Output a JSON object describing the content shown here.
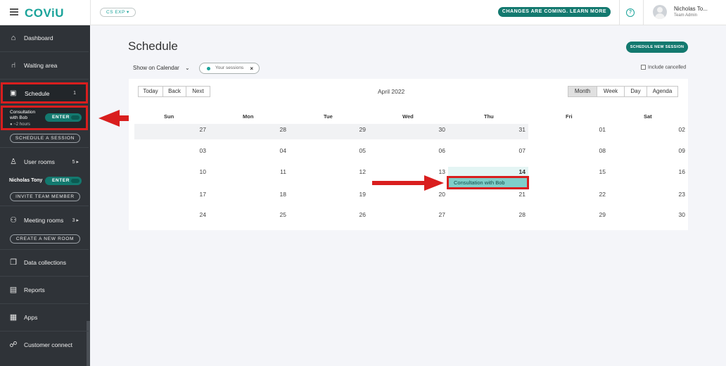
{
  "header": {
    "logo": "COViU",
    "env_label": "CS EXP",
    "changes_label": "CHANGES ARE COMING. LEARN MORE",
    "help_icon_text": "?",
    "user_name": "Nicholas To...",
    "user_role": "Team Admin"
  },
  "sidebar": {
    "items": [
      {
        "label": "Dashboard",
        "icon": "home-icon"
      },
      {
        "label": "Waiting area",
        "icon": "waiting-chair-icon"
      },
      {
        "label": "Schedule",
        "icon": "calendar-icon",
        "count": "1"
      },
      {
        "label": "User rooms",
        "icon": "user-icon",
        "count": "5"
      },
      {
        "label": "Meeting rooms",
        "icon": "group-icon",
        "count": "3"
      },
      {
        "label": "Data collections",
        "icon": "collections-icon"
      },
      {
        "label": "Reports",
        "icon": "report-icon"
      },
      {
        "label": "Apps",
        "icon": "apps-icon"
      },
      {
        "label": "Customer connect",
        "icon": "customer-connect-icon"
      }
    ],
    "consultation": {
      "title": "Consultation with Bob",
      "time": "~2 hours",
      "enter": "ENTER"
    },
    "schedule_session": "SCHEDULE A SESSION",
    "team_member": {
      "name": "Nicholas Tony",
      "enter": "ENTER"
    },
    "invite": "INVITE TEAM MEMBER",
    "create_room": "CREATE A NEW ROOM"
  },
  "main": {
    "title": "Schedule",
    "new_session": "SCHEDULE NEW SESSION",
    "show_on_calendar": "Show on Calendar",
    "filter_pill": "Your sessions",
    "include_cancelled": "Include cancelled",
    "nav_buttons": [
      "Today",
      "Back",
      "Next"
    ],
    "view_buttons": [
      "Month",
      "Week",
      "Day",
      "Agenda"
    ],
    "active_view": "Month",
    "month_label": "April 2022",
    "weekdays": [
      "Sun",
      "Mon",
      "Tue",
      "Wed",
      "Thu",
      "Fri",
      "Sat"
    ],
    "weeks": [
      [
        "27",
        "28",
        "29",
        "30",
        "31",
        "01",
        "02"
      ],
      [
        "03",
        "04",
        "05",
        "06",
        "07",
        "08",
        "09"
      ],
      [
        "10",
        "11",
        "12",
        "13",
        "14",
        "15",
        "16"
      ],
      [
        "17",
        "18",
        "19",
        "20",
        "21",
        "22",
        "23"
      ],
      [
        "24",
        "25",
        "26",
        "27",
        "28",
        "29",
        "30"
      ]
    ],
    "event": {
      "title": "Consultation with Bob",
      "day": "14"
    }
  },
  "colors": {
    "accent": "#13796f",
    "brand": "#1aa39a",
    "highlight": "#d91e1e",
    "sidebar": "#2f3338",
    "event": "#7ecfca"
  }
}
